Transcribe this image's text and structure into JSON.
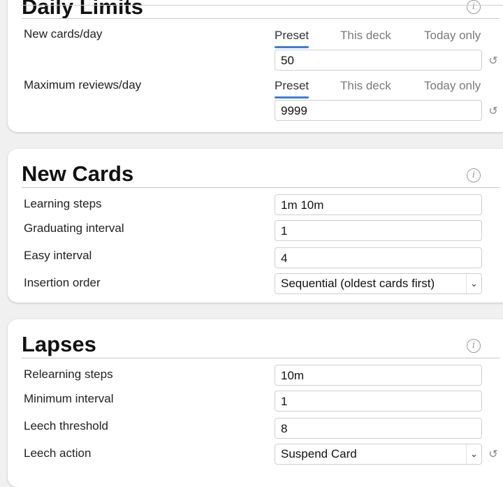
{
  "daily_limits": {
    "title": "Daily Limits",
    "new_cards": {
      "label": "New cards/day",
      "tabs": [
        "Preset",
        "This deck",
        "Today only"
      ],
      "value": "50"
    },
    "max_reviews": {
      "label": "Maximum reviews/day",
      "tabs": [
        "Preset",
        "This deck",
        "Today only"
      ],
      "value": "9999"
    }
  },
  "new_cards": {
    "title": "New Cards",
    "rows": [
      {
        "label": "Learning steps",
        "value": "1m 10m"
      },
      {
        "label": "Graduating interval",
        "value": "1"
      },
      {
        "label": "Easy interval",
        "value": "4"
      },
      {
        "label": "Insertion order",
        "value": "Sequential (oldest cards first)"
      }
    ]
  },
  "lapses": {
    "title": "Lapses",
    "rows": [
      {
        "label": "Relearning steps",
        "value": "10m"
      },
      {
        "label": "Minimum interval",
        "value": "1"
      },
      {
        "label": "Leech threshold",
        "value": "8"
      },
      {
        "label": "Leech action",
        "value": "Suspend Card"
      }
    ]
  },
  "icons": {
    "info": "info-icon",
    "revert": "revert-icon",
    "dropdown": "chevron-down-icon",
    "info_glyph": "i",
    "revert_glyph": "↺",
    "chevron_glyph": "⌄"
  },
  "colors": {
    "tab_active_underline": "#3b7ddd",
    "background": "#f0f0f0",
    "card": "#ffffff"
  }
}
